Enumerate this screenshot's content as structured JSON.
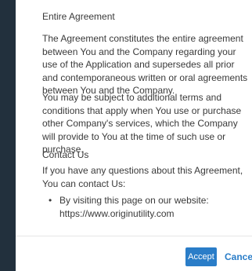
{
  "agreement": {
    "section_title": "Entire Agreement",
    "paragraph_1": "The Agreement constitutes the entire agreement between You and the Company regarding your use of the Application and supersedes all prior and contemporaneous written or oral agreements between You and the Company.",
    "paragraph_2": "You may be subject to additional terms and conditions that apply when You use or purchase other Company's services, which the Company will provide to You at the time of such use or purchase."
  },
  "contact": {
    "section_title": "Contact Us",
    "intro": "If you have any questions about this Agreement, You can contact Us:",
    "items": [
      {
        "text": "By visiting this page on our website: https://www.originutility.com"
      }
    ]
  },
  "footer": {
    "accept_label": "Accept",
    "cancel_label": "Cancel"
  },
  "colors": {
    "sidebar": "#22303d",
    "accent": "#2a7dc8",
    "text": "#3a3a3a"
  }
}
